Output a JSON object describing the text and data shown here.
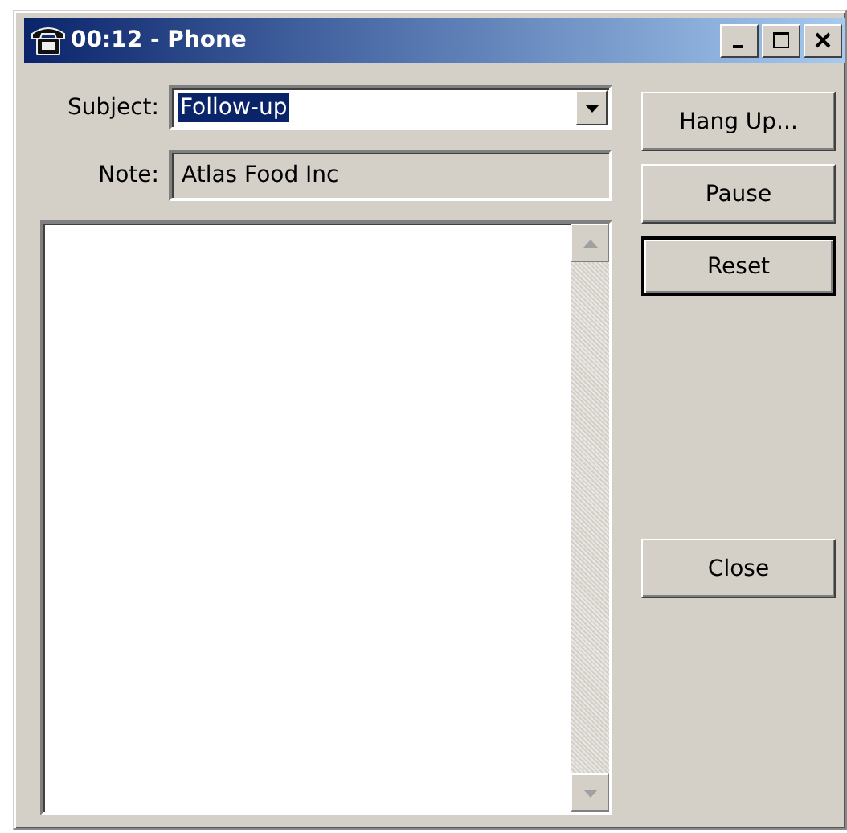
{
  "window": {
    "title": "00:12 - Phone"
  },
  "subject": {
    "label": "Subject:",
    "value": "Follow-up",
    "value_selected": true
  },
  "note": {
    "label": "Note:",
    "value": "Atlas Food Inc"
  },
  "buttons": [
    {
      "label": "Hang Up...",
      "default": false
    },
    {
      "label": "Pause",
      "default": false
    },
    {
      "label": "Reset",
      "default": true
    }
  ],
  "bottom_buttons": [
    {
      "label": "Close",
      "default": false
    }
  ]
}
